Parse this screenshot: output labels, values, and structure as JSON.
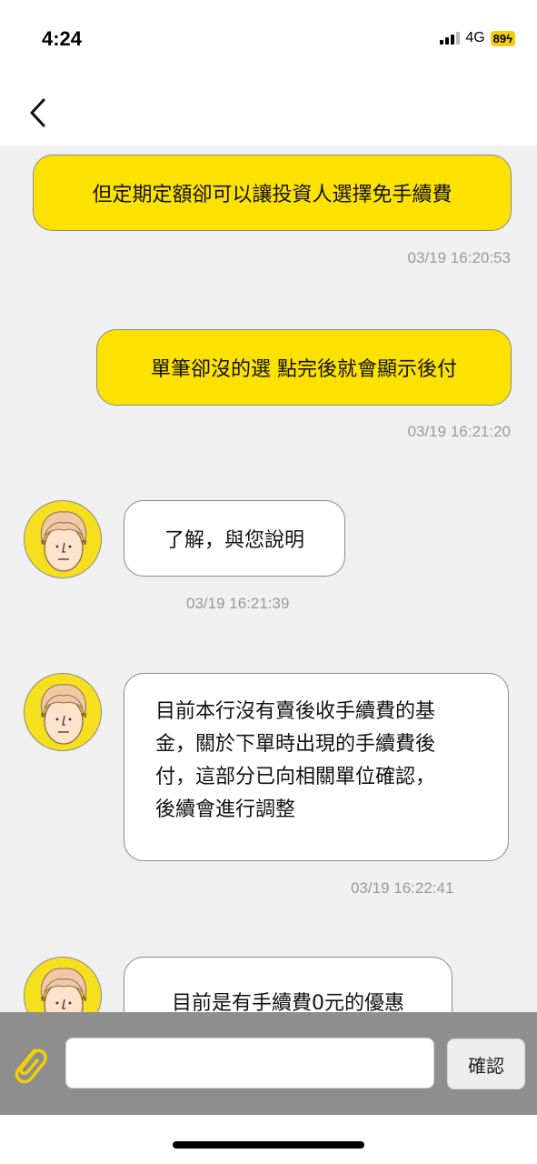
{
  "status_bar": {
    "time": "4:24",
    "network": "4G",
    "battery": "89ϟ",
    "battery_color": "#f2cf0c"
  },
  "nav": {
    "back_icon": "chevron-left-icon"
  },
  "messages": [
    {
      "side": "out",
      "text": "但定期定額卻可以讓投資人選擇免手續費",
      "time": "03/19 16:20:53"
    },
    {
      "side": "out",
      "text": "單筆卻沒的選 點完後就會顯示後付",
      "time": "03/19 16:21:20"
    },
    {
      "side": "in",
      "text": "了解，與您說明",
      "time": "03/19 16:21:39"
    },
    {
      "side": "in",
      "lines": [
        "目前本行沒有賣後收手續費的基",
        "金，關於下單時出現的手續費後",
        "付，這部分已向相關單位確認，",
        "後續會進行調整"
      ],
      "time": "03/19 16:22:41"
    },
    {
      "side": "in",
      "text": "目前是有手續費0元的優惠"
    }
  ],
  "input": {
    "placeholder": "",
    "value": "",
    "attach_icon": "paperclip-icon",
    "confirm_label": "確認"
  },
  "colors": {
    "accent": "#fde200",
    "chat_background": "#f0f0f0",
    "input_bar": "#8e8e8e",
    "avatar": "#f6df1e"
  }
}
